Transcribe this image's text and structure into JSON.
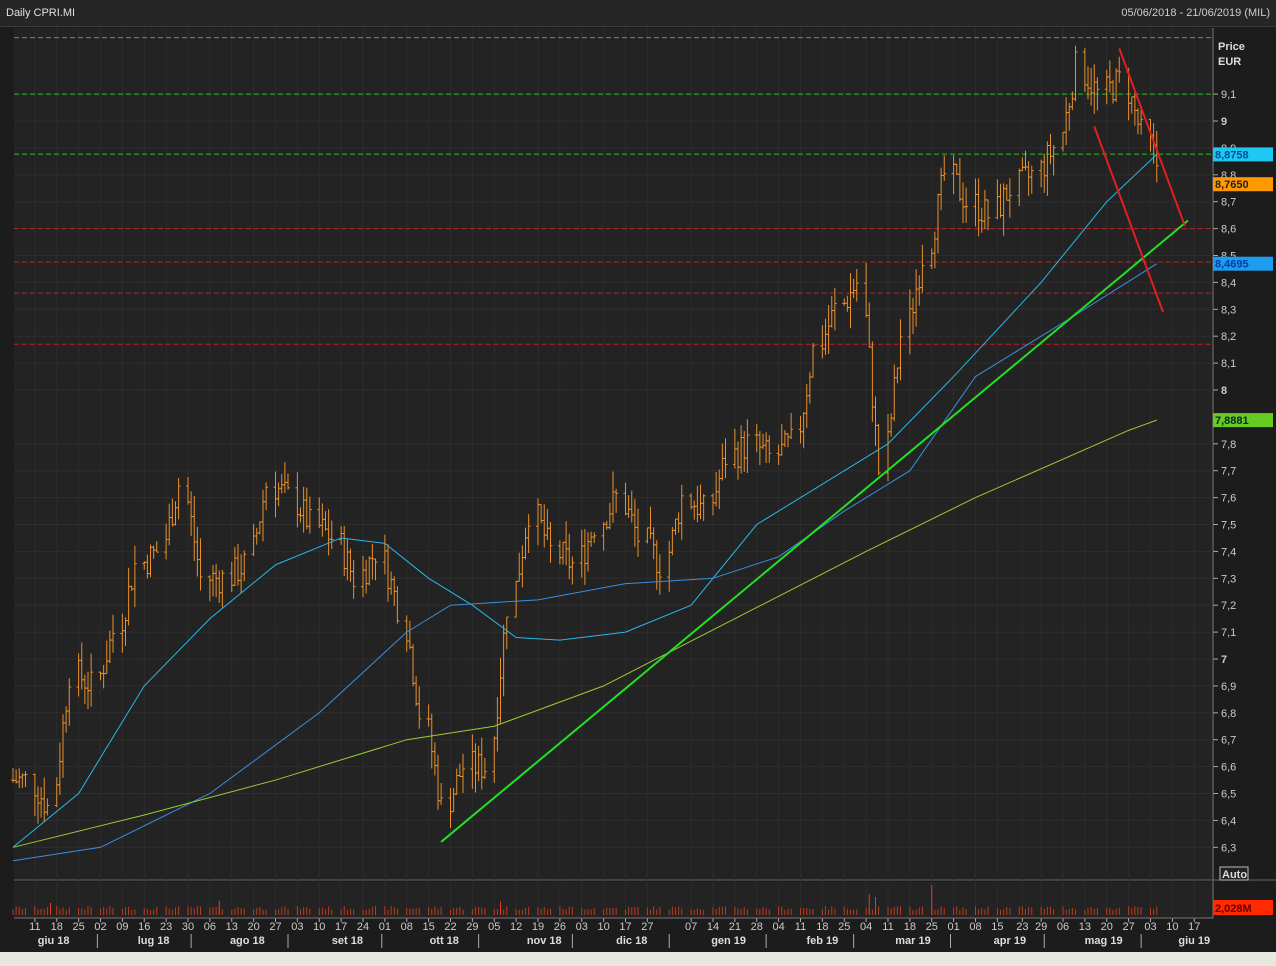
{
  "header": {
    "title": "Daily CPRI.MI",
    "range": "05/06/2018 - 21/06/2019 (MIL)"
  },
  "axis": {
    "price_label": "Price",
    "currency_label": "EUR",
    "auto_label": "Auto"
  },
  "chart_data": {
    "type": "ohlc-line",
    "title": "Daily CPRI.MI",
    "ylim": [
      6.22,
      9.33
    ],
    "y_ticks": [
      "6,3",
      "6,4",
      "6,5",
      "6,6",
      "6,7",
      "6,8",
      "6,9",
      "7",
      "7,1",
      "7,2",
      "7,3",
      "7,4",
      "7,5",
      "7,6",
      "7,7",
      "7,8",
      "8",
      "8,1",
      "8,2",
      "8,3",
      "8,4",
      "8,5",
      "8,6",
      "8,7",
      "8,8",
      "8,9",
      "9",
      "9,1"
    ],
    "x_day_ticks": [
      {
        "d": 7,
        "l": "11"
      },
      {
        "d": 14,
        "l": "18"
      },
      {
        "d": 21,
        "l": "25"
      },
      {
        "d": 28,
        "l": "02"
      },
      {
        "d": 35,
        "l": "09"
      },
      {
        "d": 42,
        "l": "16"
      },
      {
        "d": 49,
        "l": "23"
      },
      {
        "d": 56,
        "l": "30"
      },
      {
        "d": 63,
        "l": "06"
      },
      {
        "d": 70,
        "l": "13"
      },
      {
        "d": 77,
        "l": "20"
      },
      {
        "d": 84,
        "l": "27"
      },
      {
        "d": 91,
        "l": "03"
      },
      {
        "d": 98,
        "l": "10"
      },
      {
        "d": 105,
        "l": "17"
      },
      {
        "d": 112,
        "l": "24"
      },
      {
        "d": 119,
        "l": "01"
      },
      {
        "d": 126,
        "l": "08"
      },
      {
        "d": 133,
        "l": "15"
      },
      {
        "d": 140,
        "l": "22"
      },
      {
        "d": 147,
        "l": "29"
      },
      {
        "d": 154,
        "l": "05"
      },
      {
        "d": 161,
        "l": "12"
      },
      {
        "d": 168,
        "l": "19"
      },
      {
        "d": 175,
        "l": "26"
      },
      {
        "d": 182,
        "l": "03"
      },
      {
        "d": 189,
        "l": "10"
      },
      {
        "d": 196,
        "l": "17"
      },
      {
        "d": 203,
        "l": "27"
      },
      {
        "d": 217,
        "l": "07"
      },
      {
        "d": 224,
        "l": "14"
      },
      {
        "d": 231,
        "l": "21"
      },
      {
        "d": 238,
        "l": "28"
      },
      {
        "d": 245,
        "l": "04"
      },
      {
        "d": 252,
        "l": "11"
      },
      {
        "d": 259,
        "l": "18"
      },
      {
        "d": 266,
        "l": "25"
      },
      {
        "d": 273,
        "l": "04"
      },
      {
        "d": 280,
        "l": "11"
      },
      {
        "d": 287,
        "l": "18"
      },
      {
        "d": 294,
        "l": "25"
      },
      {
        "d": 301,
        "l": "01"
      },
      {
        "d": 308,
        "l": "08"
      },
      {
        "d": 315,
        "l": "15"
      },
      {
        "d": 323,
        "l": "23"
      },
      {
        "d": 329,
        "l": "29"
      },
      {
        "d": 336,
        "l": "06"
      },
      {
        "d": 343,
        "l": "13"
      },
      {
        "d": 350,
        "l": "20"
      },
      {
        "d": 357,
        "l": "27"
      },
      {
        "d": 364,
        "l": "03"
      },
      {
        "d": 371,
        "l": "10"
      },
      {
        "d": 378,
        "l": "17"
      }
    ],
    "x_months": [
      {
        "d": 13,
        "l": "giu 18"
      },
      {
        "d": 45,
        "l": "lug 18"
      },
      {
        "d": 75,
        "l": "ago 18"
      },
      {
        "d": 107,
        "l": "set 18"
      },
      {
        "d": 138,
        "l": "ott 18"
      },
      {
        "d": 170,
        "l": "nov 18"
      },
      {
        "d": 198,
        "l": "dic 18"
      },
      {
        "d": 229,
        "l": "gen 19"
      },
      {
        "d": 259,
        "l": "feb 19"
      },
      {
        "d": 288,
        "l": "mar 19"
      },
      {
        "d": 319,
        "l": "apr 19"
      },
      {
        "d": 349,
        "l": "mag 19"
      },
      {
        "d": 378,
        "l": "giu 19"
      }
    ],
    "x_month_seps": [
      27,
      57,
      88,
      118,
      149,
      179,
      210,
      241,
      269,
      300,
      330,
      361
    ],
    "weekly_close": [
      6.55,
      6.45,
      6.95,
      6.9,
      7.1,
      7.35,
      7.4,
      7.65,
      7.3,
      7.3,
      7.35,
      7.65,
      7.6,
      7.5,
      7.45,
      7.3,
      7.4,
      7.2,
      6.8,
      6.45,
      6.6,
      6.6,
      7.2,
      7.55,
      7.4,
      7.35,
      7.5,
      7.6,
      7.45,
      7.35,
      7.6,
      7.55,
      7.75,
      7.8,
      7.75,
      7.8,
      8.15,
      8.3,
      8.4,
      7.7,
      8.2,
      8.5,
      8.8,
      8.7,
      8.65,
      8.75,
      8.8,
      8.9,
      9.2,
      9.1,
      9.15,
      8.95,
      8.765
    ],
    "series": [
      {
        "name": "MA short",
        "color": "#29b6e8",
        "days": [
          0,
          21,
          42,
          63,
          84,
          105,
          119,
          133,
          147,
          161,
          175,
          196,
          217,
          238,
          259,
          280,
          301,
          329,
          350,
          366
        ],
        "values": [
          6.3,
          6.5,
          6.9,
          7.15,
          7.35,
          7.45,
          7.43,
          7.3,
          7.2,
          7.08,
          7.07,
          7.1,
          7.2,
          7.5,
          7.65,
          7.8,
          8.05,
          8.4,
          8.7,
          8.8758
        ]
      },
      {
        "name": "MA medium",
        "color": "#3a8fe0",
        "days": [
          0,
          28,
          63,
          98,
          126,
          140,
          168,
          196,
          224,
          245,
          266,
          287,
          308,
          336,
          366
        ],
        "values": [
          6.25,
          6.3,
          6.5,
          6.8,
          7.1,
          7.2,
          7.22,
          7.28,
          7.3,
          7.38,
          7.55,
          7.7,
          8.05,
          8.25,
          8.4695
        ]
      },
      {
        "name": "MA long",
        "color": "#9acd32",
        "days": [
          0,
          42,
          84,
          126,
          154,
          189,
          231,
          273,
          308,
          357,
          366
        ],
        "values": [
          6.3,
          6.42,
          6.55,
          6.7,
          6.75,
          6.9,
          7.15,
          7.4,
          7.6,
          7.85,
          7.8881
        ]
      }
    ],
    "trendlines": [
      {
        "color": "#22e022",
        "from": [
          137,
          6.32
        ],
        "to": [
          376,
          8.63
        ]
      },
      {
        "color": "#e02020",
        "from": [
          354,
          9.27
        ],
        "to": [
          375,
          8.61
        ]
      },
      {
        "color": "#e02020",
        "from": [
          346,
          8.98
        ],
        "to": [
          368,
          8.29
        ]
      }
    ],
    "hlines": [
      {
        "v": 9.31,
        "c": "#2eb82e"
      },
      {
        "v": 9.1,
        "c": "#2eb82e"
      },
      {
        "v": 8.877,
        "c": "#2eb82e"
      },
      {
        "v": 8.6,
        "c": "#b02828"
      },
      {
        "v": 8.476,
        "c": "#b02828"
      },
      {
        "v": 8.36,
        "c": "#b02828"
      },
      {
        "v": 8.17,
        "c": "#b02828"
      }
    ],
    "price_tags": [
      {
        "label": "8,8758",
        "v": 8.8758,
        "bg": "#1ec8f0",
        "fg": "#0050a0"
      },
      {
        "label": "8,7650",
        "v": 8.765,
        "bg": "#ff9900",
        "fg": "#222"
      },
      {
        "label": "8,4695",
        "v": 8.4695,
        "bg": "#1e9cf0",
        "fg": "#0040a0"
      },
      {
        "label": "7,8881",
        "v": 7.8881,
        "bg": "#66cc22",
        "fg": "#123"
      }
    ],
    "volume": {
      "last_label": "2,028M",
      "spikes": [
        {
          "d": 12,
          "h": 2
        },
        {
          "d": 66,
          "h": 2.4
        },
        {
          "d": 156,
          "h": 2.2
        },
        {
          "d": 274,
          "h": 3.5
        },
        {
          "d": 276,
          "h": 3
        },
        {
          "d": 294,
          "h": 5
        }
      ]
    }
  }
}
